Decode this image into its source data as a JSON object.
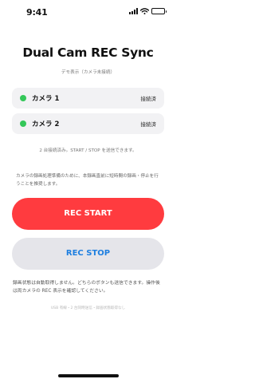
{
  "status_bar": {
    "time": "9:41"
  },
  "app": {
    "title": "Dual Cam REC Sync",
    "subtitle": "デモ表示（カメラ未接続）"
  },
  "cameras": [
    {
      "name": "カメラ 1",
      "status": "接続済",
      "status_color": "#34c759"
    },
    {
      "name": "カメラ 2",
      "status": "接続済",
      "status_color": "#34c759"
    }
  ],
  "info": {
    "connection_message": "2 台接続済み。START / STOP を送信できます。",
    "advice": "カメラの録画処理準備のために、本録画直前に短時間の録画・停止を行うことを推奨します。"
  },
  "buttons": {
    "start_label": "REC START",
    "stop_label": "REC STOP",
    "start_color": "#ff3b3f",
    "stop_text_color": "#1e7fe0"
  },
  "note": "録画状態は自動取得しません。どちらのボタンも送信できます。操作後は両カメラの REC 表示を確認してください。",
  "footer": "USB 有線・2 台同時送信・録画状態取得なし"
}
